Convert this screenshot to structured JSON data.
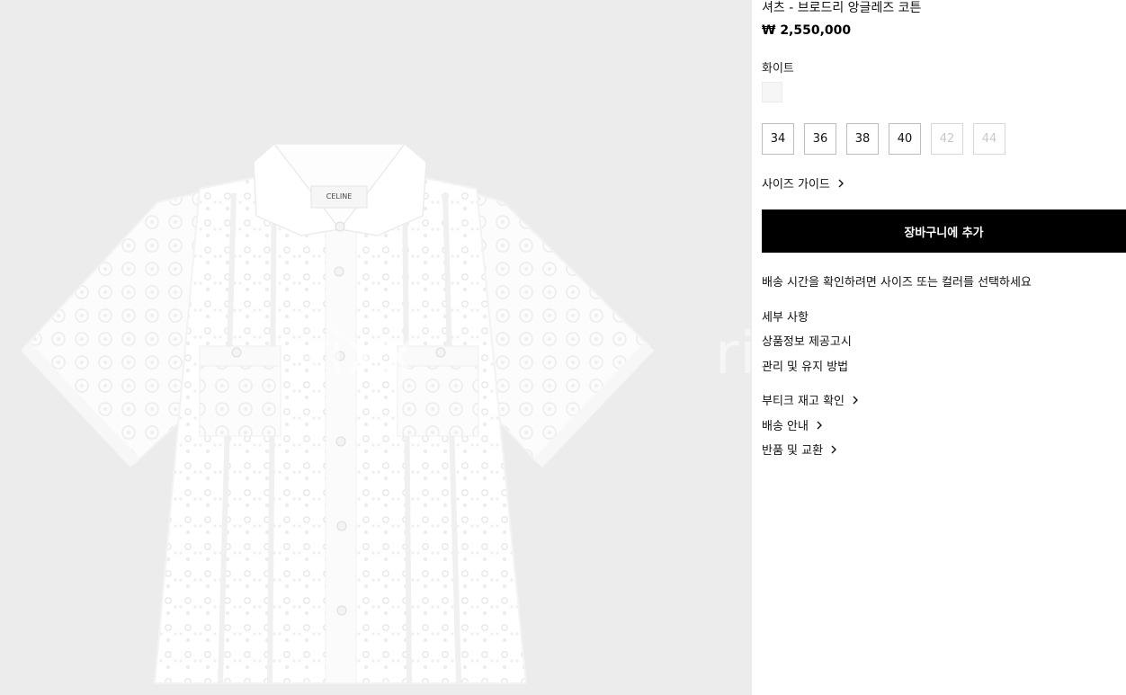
{
  "product": {
    "title": "셔츠 - 브로드리 앙글레즈 코튼",
    "price": "₩ 2,550,000",
    "color_name": "화이트",
    "swatch_color": "#f6f6f6",
    "label_brand": "CELINE",
    "watermark": "rixx"
  },
  "sizes": [
    {
      "label": "34",
      "available": true
    },
    {
      "label": "36",
      "available": true
    },
    {
      "label": "38",
      "available": true
    },
    {
      "label": "40",
      "available": true
    },
    {
      "label": "42",
      "available": false
    },
    {
      "label": "44",
      "available": false
    }
  ],
  "actions": {
    "size_guide": "사이즈 가이드",
    "add_to_cart": "장바구니에 추가",
    "shipping_note": "배송 시간을 확인하려면 사이즈 또는 컬러를 선택하세요"
  },
  "info_links": {
    "details": "세부 사항",
    "product_notice": "상품정보 제공고시",
    "care": "관리 및 유지 방법",
    "boutique_stock": "부티크 재고 확인",
    "shipping_info": "배송 안내",
    "returns": "반품 및 교환"
  },
  "colors": {
    "gallery_bg": "#ececec",
    "cart_button_bg": "#000000",
    "cart_button_text": "#ffffff"
  },
  "icons": {
    "chevron": "chevron-right-icon"
  }
}
